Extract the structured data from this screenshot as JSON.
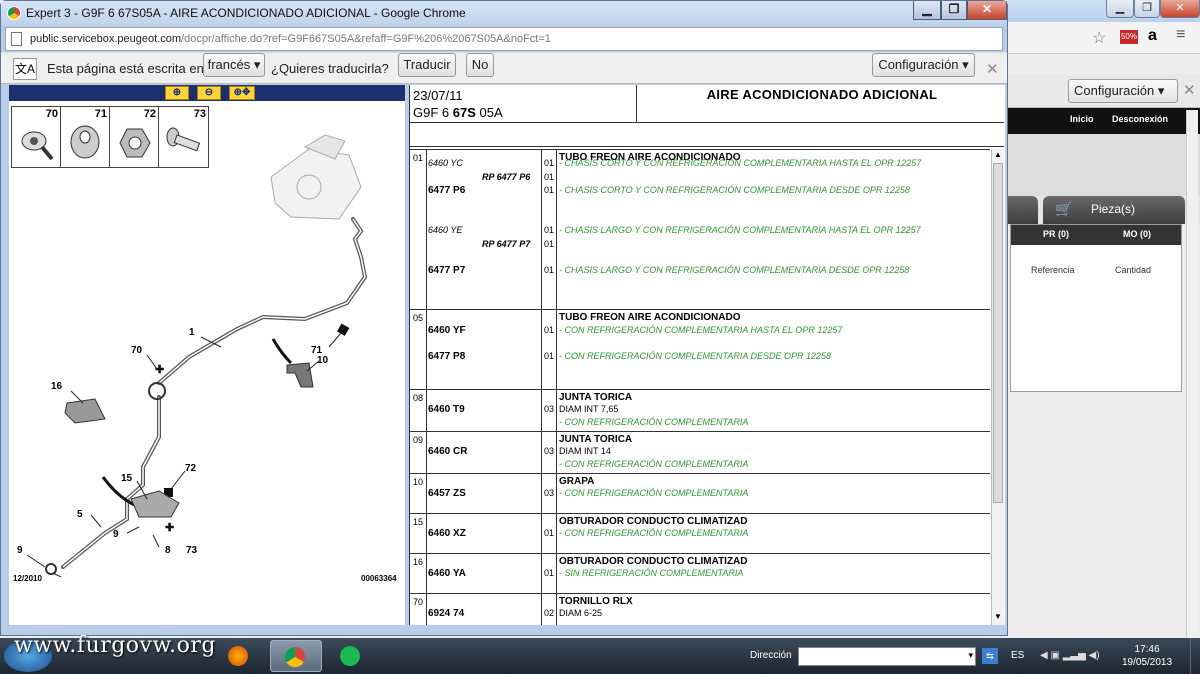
{
  "background_window": {
    "config_label": "Configuración",
    "nav": [
      "Inicio",
      "Desconexión"
    ],
    "tab_label": "Pieza(s)",
    "panel_headers": [
      "PR (0)",
      "MO (0)"
    ],
    "panel_columns": [
      "Referencia",
      "Cantidad"
    ]
  },
  "window": {
    "title": "Expert 3 - G9F 6 67S05A - AIRE ACONDICIONADO ADICIONAL - Google Chrome",
    "url_host": "public.servicebox.peugeot.com",
    "url_path": "/docpr/affiche.do?ref=G9F667S05A&refaff=G9F%206%2067S05A&noFct=1"
  },
  "translate_bar": {
    "message": "Esta página está escrita en",
    "language": "francés",
    "question": "¿Quieres traducirla?",
    "translate_button": "Traducir",
    "no_button": "No",
    "config_button": "Configuración"
  },
  "diagram": {
    "parts_row": [
      "70",
      "71",
      "72",
      "73"
    ],
    "labels": [
      "71",
      "1",
      "70",
      "10",
      "16",
      "15",
      "72",
      "9",
      "8",
      "73",
      "5",
      "9",
      "8"
    ],
    "date_code": "12/2010",
    "figure_id": "00063364"
  },
  "header": {
    "date": "23/07/11",
    "ref_prefix": "G9F 6",
    "ref_bold": "67S",
    "ref_suffix": "05A",
    "title": "AIRE ACONDICIONADO ADICIONAL"
  },
  "groups": [
    {
      "num": "01",
      "title": "TUBO FREON AIRE ACONDICIONADO",
      "lines": [
        {
          "ref": "6460 YC",
          "ref_style": "it",
          "qty": "01",
          "desc": "- CHASIS CORTO Y CON REFRIGERACIÓN COMPLEMENTARIA HASTA EL OPR 12257"
        },
        {
          "ref": "RP 6477 P6",
          "ref_style": "rp",
          "qty": "01",
          "desc": ""
        },
        {
          "ref": "6477 P6",
          "ref_style": "bd",
          "qty": "01",
          "desc": "- CHASIS CORTO Y CON REFRIGERACIÓN COMPLEMENTARIA DESDE OPR 12258"
        },
        {
          "ref": "6460 YE",
          "ref_style": "it",
          "qty": "01",
          "desc": "- CHASIS LARGO Y CON REFRIGERACIÓN COMPLEMENTARIA HASTA EL OPR 12257"
        },
        {
          "ref": "RP 6477 P7",
          "ref_style": "rp",
          "qty": "01",
          "desc": ""
        },
        {
          "ref": "6477 P7",
          "ref_style": "bd",
          "qty": "01",
          "desc": "- CHASIS LARGO Y CON REFRIGERACIÓN COMPLEMENTARIA DESDE OPR 12258"
        }
      ]
    },
    {
      "num": "05",
      "title": "TUBO FREON AIRE ACONDICIONADO",
      "lines": [
        {
          "ref": "6460 YF",
          "ref_style": "bd",
          "qty": "01",
          "desc": "- CON REFRIGERACIÓN COMPLEMENTARIA HASTA EL OPR 12257"
        },
        {
          "ref": "6477 P8",
          "ref_style": "bd",
          "qty": "01",
          "desc": "- CON REFRIGERACIÓN COMPLEMENTARIA DESDE OPR 12258"
        }
      ]
    },
    {
      "num": "08",
      "title": "JUNTA TORICA",
      "lines": [
        {
          "ref": "6460 T9",
          "ref_style": "bd",
          "qty": "03",
          "desc": "DIAM INT 7,65",
          "desc2": "- CON REFRIGERACIÓN COMPLEMENTARIA"
        }
      ]
    },
    {
      "num": "09",
      "title": "JUNTA TORICA",
      "lines": [
        {
          "ref": "6460 CR",
          "ref_style": "bd",
          "qty": "03",
          "desc": "DIAM INT 14",
          "desc2": "- CON REFRIGERACIÓN COMPLEMENTARIA"
        }
      ]
    },
    {
      "num": "10",
      "title": "GRAPA",
      "lines": [
        {
          "ref": "6457 ZS",
          "ref_style": "bd",
          "qty": "03",
          "desc": "- CON REFRIGERACIÓN COMPLEMENTARIA"
        }
      ]
    },
    {
      "num": "15",
      "title": "OBTURADOR CONDUCTO CLIMATIZAD",
      "lines": [
        {
          "ref": "6460 XZ",
          "ref_style": "bd",
          "qty": "01",
          "desc": "- CON REFRIGERACIÓN COMPLEMENTARIA"
        }
      ]
    },
    {
      "num": "16",
      "title": "OBTURADOR CONDUCTO CLIMATIZAD",
      "lines": [
        {
          "ref": "6460 YA",
          "ref_style": "bd",
          "qty": "01",
          "desc": "- SIN REFRIGERACIÓN COMPLEMENTARIA"
        }
      ]
    },
    {
      "num": "70",
      "title": "TORNILLO RLX",
      "lines": [
        {
          "ref": "6924 74",
          "ref_style": "bd",
          "qty": "02",
          "desc": "DIAM 6-25",
          "desc_plain": true
        }
      ]
    }
  ],
  "taskbar": {
    "watermark": "www.furgovw.org",
    "address_label": "Dirección",
    "lang": "ES",
    "time": "17:46",
    "date": "19/05/2013"
  }
}
